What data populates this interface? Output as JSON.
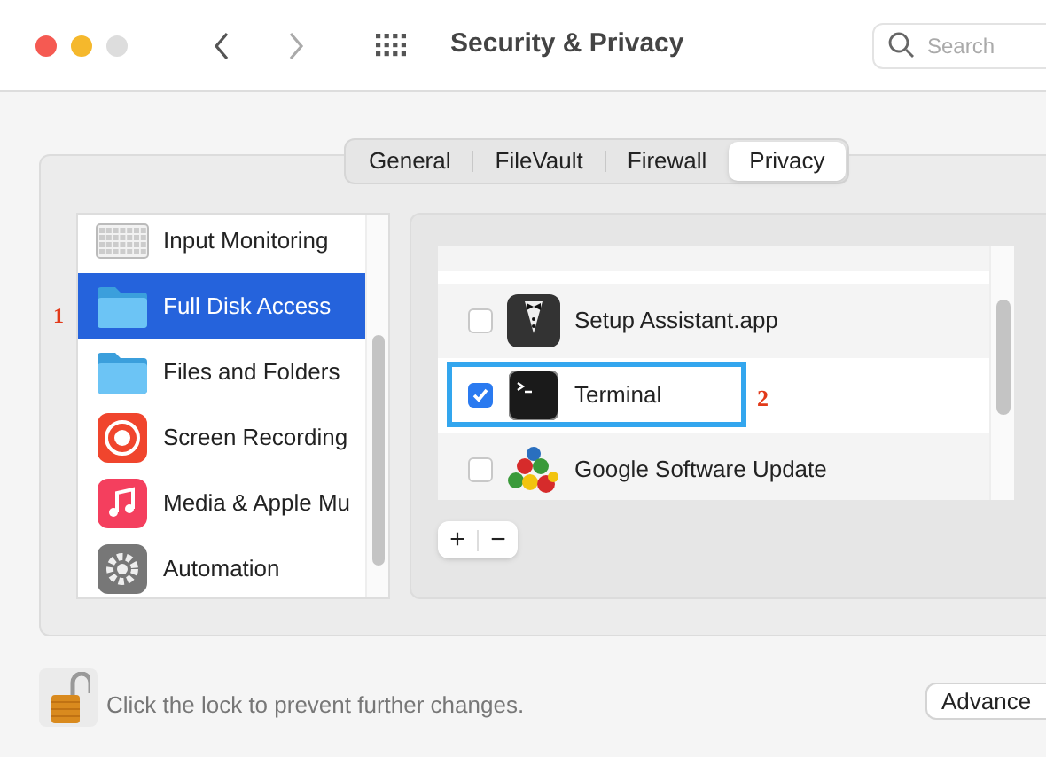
{
  "window": {
    "title": "Security & Privacy"
  },
  "search": {
    "placeholder": "Search"
  },
  "tabs": [
    {
      "label": "General",
      "selected": false
    },
    {
      "label": "FileVault",
      "selected": false
    },
    {
      "label": "Firewall",
      "selected": false
    },
    {
      "label": "Privacy",
      "selected": true
    }
  ],
  "sidebar": {
    "items": [
      {
        "label": "Input Monitoring",
        "kind": "keyboard",
        "selected": false
      },
      {
        "label": "Full Disk Access",
        "kind": "folder",
        "selected": true,
        "annotation": "1"
      },
      {
        "label": "Files and Folders",
        "kind": "folder",
        "selected": false
      },
      {
        "label": "Screen Recording",
        "kind": "record",
        "selected": false
      },
      {
        "label": "Media & Apple Mu",
        "kind": "music",
        "selected": false
      },
      {
        "label": "Automation",
        "kind": "gear",
        "selected": false
      }
    ]
  },
  "apps": [
    {
      "name": "Setup Assistant.app",
      "kind": "tuxedo",
      "checked": false,
      "highlighted": false
    },
    {
      "name": "Terminal",
      "kind": "terminal",
      "checked": true,
      "highlighted": true,
      "annotation": "2"
    },
    {
      "name": "Google Software Update",
      "kind": "balls",
      "checked": false,
      "highlighted": false
    }
  ],
  "list_buttons": [
    "+",
    "−"
  ],
  "footer": {
    "lock_text": "Click the lock to prevent further changes.",
    "button": "Advance"
  }
}
